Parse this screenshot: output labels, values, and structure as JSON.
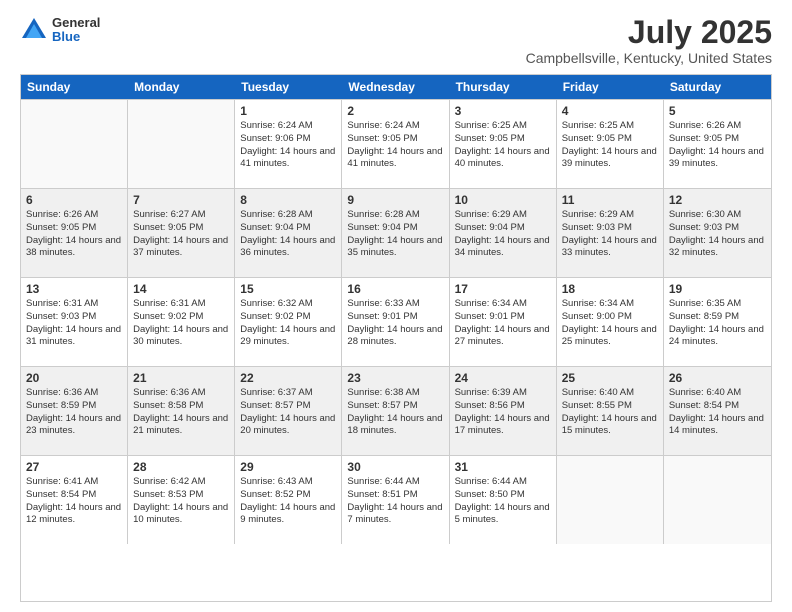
{
  "logo": {
    "general": "General",
    "blue": "Blue"
  },
  "title": "July 2025",
  "location": "Campbellsville, Kentucky, United States",
  "header_days": [
    "Sunday",
    "Monday",
    "Tuesday",
    "Wednesday",
    "Thursday",
    "Friday",
    "Saturday"
  ],
  "weeks": [
    [
      {
        "day": "",
        "sunrise": "",
        "sunset": "",
        "daylight": ""
      },
      {
        "day": "",
        "sunrise": "",
        "sunset": "",
        "daylight": ""
      },
      {
        "day": "1",
        "sunrise": "Sunrise: 6:24 AM",
        "sunset": "Sunset: 9:06 PM",
        "daylight": "Daylight: 14 hours and 41 minutes."
      },
      {
        "day": "2",
        "sunrise": "Sunrise: 6:24 AM",
        "sunset": "Sunset: 9:05 PM",
        "daylight": "Daylight: 14 hours and 41 minutes."
      },
      {
        "day": "3",
        "sunrise": "Sunrise: 6:25 AM",
        "sunset": "Sunset: 9:05 PM",
        "daylight": "Daylight: 14 hours and 40 minutes."
      },
      {
        "day": "4",
        "sunrise": "Sunrise: 6:25 AM",
        "sunset": "Sunset: 9:05 PM",
        "daylight": "Daylight: 14 hours and 39 minutes."
      },
      {
        "day": "5",
        "sunrise": "Sunrise: 6:26 AM",
        "sunset": "Sunset: 9:05 PM",
        "daylight": "Daylight: 14 hours and 39 minutes."
      }
    ],
    [
      {
        "day": "6",
        "sunrise": "Sunrise: 6:26 AM",
        "sunset": "Sunset: 9:05 PM",
        "daylight": "Daylight: 14 hours and 38 minutes."
      },
      {
        "day": "7",
        "sunrise": "Sunrise: 6:27 AM",
        "sunset": "Sunset: 9:05 PM",
        "daylight": "Daylight: 14 hours and 37 minutes."
      },
      {
        "day": "8",
        "sunrise": "Sunrise: 6:28 AM",
        "sunset": "Sunset: 9:04 PM",
        "daylight": "Daylight: 14 hours and 36 minutes."
      },
      {
        "day": "9",
        "sunrise": "Sunrise: 6:28 AM",
        "sunset": "Sunset: 9:04 PM",
        "daylight": "Daylight: 14 hours and 35 minutes."
      },
      {
        "day": "10",
        "sunrise": "Sunrise: 6:29 AM",
        "sunset": "Sunset: 9:04 PM",
        "daylight": "Daylight: 14 hours and 34 minutes."
      },
      {
        "day": "11",
        "sunrise": "Sunrise: 6:29 AM",
        "sunset": "Sunset: 9:03 PM",
        "daylight": "Daylight: 14 hours and 33 minutes."
      },
      {
        "day": "12",
        "sunrise": "Sunrise: 6:30 AM",
        "sunset": "Sunset: 9:03 PM",
        "daylight": "Daylight: 14 hours and 32 minutes."
      }
    ],
    [
      {
        "day": "13",
        "sunrise": "Sunrise: 6:31 AM",
        "sunset": "Sunset: 9:03 PM",
        "daylight": "Daylight: 14 hours and 31 minutes."
      },
      {
        "day": "14",
        "sunrise": "Sunrise: 6:31 AM",
        "sunset": "Sunset: 9:02 PM",
        "daylight": "Daylight: 14 hours and 30 minutes."
      },
      {
        "day": "15",
        "sunrise": "Sunrise: 6:32 AM",
        "sunset": "Sunset: 9:02 PM",
        "daylight": "Daylight: 14 hours and 29 minutes."
      },
      {
        "day": "16",
        "sunrise": "Sunrise: 6:33 AM",
        "sunset": "Sunset: 9:01 PM",
        "daylight": "Daylight: 14 hours and 28 minutes."
      },
      {
        "day": "17",
        "sunrise": "Sunrise: 6:34 AM",
        "sunset": "Sunset: 9:01 PM",
        "daylight": "Daylight: 14 hours and 27 minutes."
      },
      {
        "day": "18",
        "sunrise": "Sunrise: 6:34 AM",
        "sunset": "Sunset: 9:00 PM",
        "daylight": "Daylight: 14 hours and 25 minutes."
      },
      {
        "day": "19",
        "sunrise": "Sunrise: 6:35 AM",
        "sunset": "Sunset: 8:59 PM",
        "daylight": "Daylight: 14 hours and 24 minutes."
      }
    ],
    [
      {
        "day": "20",
        "sunrise": "Sunrise: 6:36 AM",
        "sunset": "Sunset: 8:59 PM",
        "daylight": "Daylight: 14 hours and 23 minutes."
      },
      {
        "day": "21",
        "sunrise": "Sunrise: 6:36 AM",
        "sunset": "Sunset: 8:58 PM",
        "daylight": "Daylight: 14 hours and 21 minutes."
      },
      {
        "day": "22",
        "sunrise": "Sunrise: 6:37 AM",
        "sunset": "Sunset: 8:57 PM",
        "daylight": "Daylight: 14 hours and 20 minutes."
      },
      {
        "day": "23",
        "sunrise": "Sunrise: 6:38 AM",
        "sunset": "Sunset: 8:57 PM",
        "daylight": "Daylight: 14 hours and 18 minutes."
      },
      {
        "day": "24",
        "sunrise": "Sunrise: 6:39 AM",
        "sunset": "Sunset: 8:56 PM",
        "daylight": "Daylight: 14 hours and 17 minutes."
      },
      {
        "day": "25",
        "sunrise": "Sunrise: 6:40 AM",
        "sunset": "Sunset: 8:55 PM",
        "daylight": "Daylight: 14 hours and 15 minutes."
      },
      {
        "day": "26",
        "sunrise": "Sunrise: 6:40 AM",
        "sunset": "Sunset: 8:54 PM",
        "daylight": "Daylight: 14 hours and 14 minutes."
      }
    ],
    [
      {
        "day": "27",
        "sunrise": "Sunrise: 6:41 AM",
        "sunset": "Sunset: 8:54 PM",
        "daylight": "Daylight: 14 hours and 12 minutes."
      },
      {
        "day": "28",
        "sunrise": "Sunrise: 6:42 AM",
        "sunset": "Sunset: 8:53 PM",
        "daylight": "Daylight: 14 hours and 10 minutes."
      },
      {
        "day": "29",
        "sunrise": "Sunrise: 6:43 AM",
        "sunset": "Sunset: 8:52 PM",
        "daylight": "Daylight: 14 hours and 9 minutes."
      },
      {
        "day": "30",
        "sunrise": "Sunrise: 6:44 AM",
        "sunset": "Sunset: 8:51 PM",
        "daylight": "Daylight: 14 hours and 7 minutes."
      },
      {
        "day": "31",
        "sunrise": "Sunrise: 6:44 AM",
        "sunset": "Sunset: 8:50 PM",
        "daylight": "Daylight: 14 hours and 5 minutes."
      },
      {
        "day": "",
        "sunrise": "",
        "sunset": "",
        "daylight": ""
      },
      {
        "day": "",
        "sunrise": "",
        "sunset": "",
        "daylight": ""
      }
    ]
  ]
}
